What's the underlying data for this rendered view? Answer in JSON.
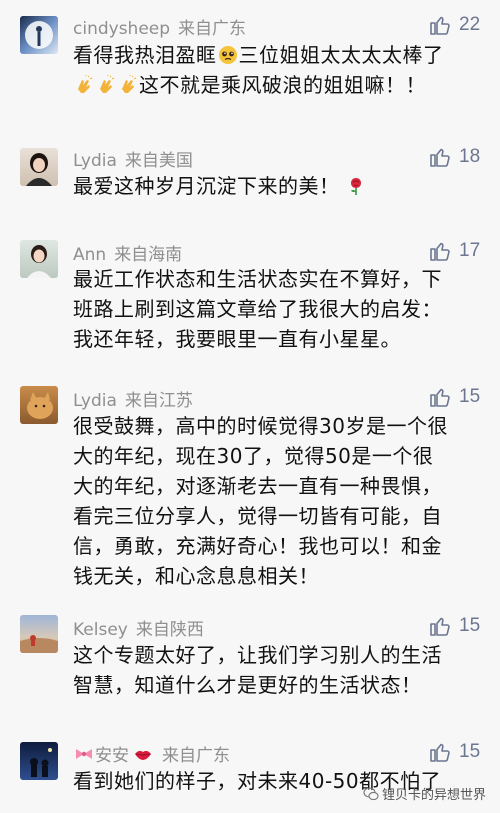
{
  "comments": [
    {
      "name": "cindysheep",
      "location": "来自广东",
      "likes": "22",
      "line1": "看得我热泪盈眶",
      "line1b": "三位姐姐太太太太棒了",
      "line2": "这不就是乘风破浪的姐姐嘛！！"
    },
    {
      "name": "Lydia",
      "location": "来自美国",
      "likes": "18",
      "line1": "最爱这种岁月沉淀下来的美！"
    },
    {
      "name": "Ann",
      "location": "来自海南",
      "likes": "17",
      "line1": "最近工作状态和生活状态实在不算好，下",
      "line2": "班路上刷到这篇文章给了我很大的启发：",
      "line3": "我还年轻，我要眼里一直有小星星。"
    },
    {
      "name": "Lydia",
      "location": "来自江苏",
      "likes": "15",
      "line1": "很受鼓舞，高中的时候觉得30岁是一个很",
      "line2": "大的年纪，现在30了，觉得50是一个很",
      "line3": "大的年纪，对逐渐老去一直有一种畏惧，",
      "line4": "看完三位分享人，觉得一切皆有可能，自",
      "line5": "信，勇敢，充满好奇心！我也可以！和金",
      "line6": "钱无关，和心念息息相关！"
    },
    {
      "name": "Kelsey",
      "location": "来自陕西",
      "likes": "15",
      "line1": "这个专题太好了，让我们学习别人的生活",
      "line2": "智慧，知道什么才是更好的生活状态！"
    },
    {
      "name": "安安",
      "location": "来自广东",
      "likes": "15",
      "line1": "看到她们的样子，对未来40-50都不怕了"
    }
  ],
  "watermark": "锂贝卡的异想世界",
  "colors": {
    "background": "#f7f7f7",
    "name": "#8f8f8f",
    "like": "#6d7690",
    "text": "#111111"
  },
  "icons": [
    "thumbs-up-icon",
    "pleading-face-emoji",
    "clapping-hands-emoji",
    "rose-emoji",
    "bow-emoji",
    "lips-emoji",
    "wechat-icon"
  ]
}
